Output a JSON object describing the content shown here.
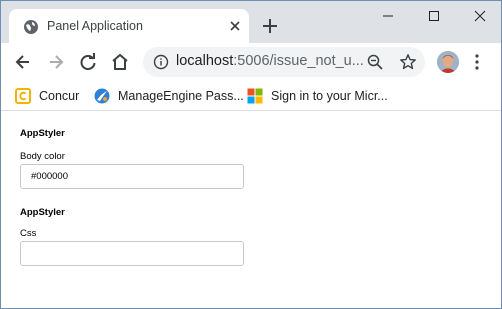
{
  "browser": {
    "tab": {
      "title": "Panel Application",
      "favicon": "globe-icon"
    },
    "toolbar": {
      "url_host": "localhost",
      "url_rest": ":5006/issue_not_u...",
      "icons": [
        "back-arrow-icon",
        "forward-arrow-icon",
        "reload-icon",
        "home-icon",
        "info-icon",
        "zoom-icon",
        "star-icon",
        "menu-icon"
      ]
    },
    "bookmarks": [
      {
        "label": "Concur",
        "icon": "concur-icon"
      },
      {
        "label": "ManageEngine Pass...",
        "icon": "manageengine-icon"
      },
      {
        "label": "Sign in to your Micr...",
        "icon": "microsoft-icon"
      }
    ]
  },
  "app": {
    "sections": [
      {
        "title": "AppStyler",
        "field_label": "Body color",
        "value": "#000000",
        "placeholder": ""
      },
      {
        "title": "AppStyler",
        "field_label": "Css",
        "value": "",
        "placeholder": ""
      }
    ]
  },
  "colors": {
    "chrome_bg": "#dee1e6",
    "omnibox_bg": "#f1f3f4",
    "input_border": "#c9c9c9"
  }
}
